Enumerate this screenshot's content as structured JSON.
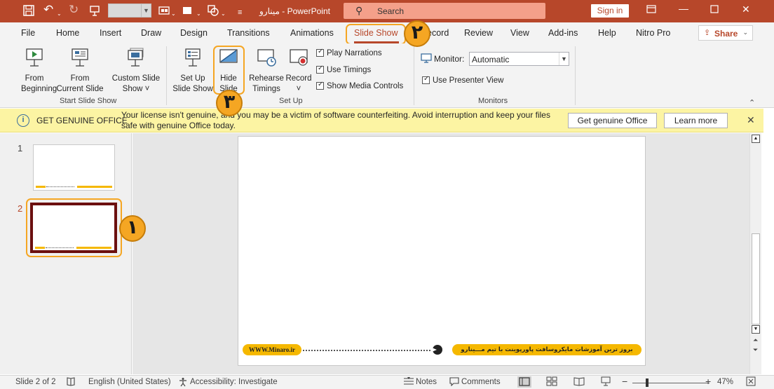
{
  "titlebar": {
    "title": "مینارو  -  PowerPoint",
    "search_label": "Search",
    "signin_label": "Sign in"
  },
  "tabs": [
    "File",
    "Home",
    "Insert",
    "Draw",
    "Design",
    "Transitions",
    "Animations",
    "Slide Show",
    "Record",
    "Review",
    "View",
    "Add-ins",
    "Help",
    "Nitro Pro"
  ],
  "active_tab": "Slide Show",
  "share_label": "Share",
  "ribbon": {
    "start_group": {
      "from_beginning": [
        "From",
        "Beginning"
      ],
      "from_current": [
        "From",
        "Current Slide"
      ],
      "custom_show": [
        "Custom Slide",
        "Show ˅"
      ],
      "label": "Start Slide Show"
    },
    "setup_group": {
      "setup_show": [
        "Set Up",
        "Slide Show"
      ],
      "hide_slide": [
        "Hide",
        "Slide"
      ],
      "rehearse": [
        "Rehearse",
        "Timings"
      ],
      "record": [
        "Record",
        "˅"
      ],
      "play_narrations": "Play Narrations",
      "use_timings": "Use Timings",
      "show_media_controls": "Show Media Controls",
      "label": "Set Up"
    },
    "monitors_group": {
      "monitor_label": "Monitor:",
      "monitor_value": "Automatic",
      "presenter_view": "Use Presenter View",
      "label": "Monitors"
    }
  },
  "notice": {
    "title": "GET GENUINE OFFICE",
    "message": "Your license isn't genuine, and you may be a victim of software counterfeiting. Avoid interruption and keep your files safe with genuine Office today.",
    "primary_button": "Get genuine Office",
    "secondary_button": "Learn more"
  },
  "slides": [
    {
      "number": "1"
    },
    {
      "number": "2"
    }
  ],
  "slide_footer": {
    "url": "WWW.Minaro.ir",
    "tagline": "بروز ترین آموزشات مایکروسافت پاورپوینت با تیم مـــینارو"
  },
  "badges": {
    "one": "١",
    "two": "٢",
    "three": "٣"
  },
  "status": {
    "slide_info": "Slide 2 of 2",
    "language": "English (United States)",
    "accessibility": "Accessibility: Investigate",
    "notes": "Notes",
    "comments": "Comments",
    "zoom": "47%"
  },
  "colors": {
    "accent": "#b7472a",
    "highlight": "#f5a623",
    "notice_bg": "#fcf4a3",
    "slide_bar": "#f5b800"
  }
}
